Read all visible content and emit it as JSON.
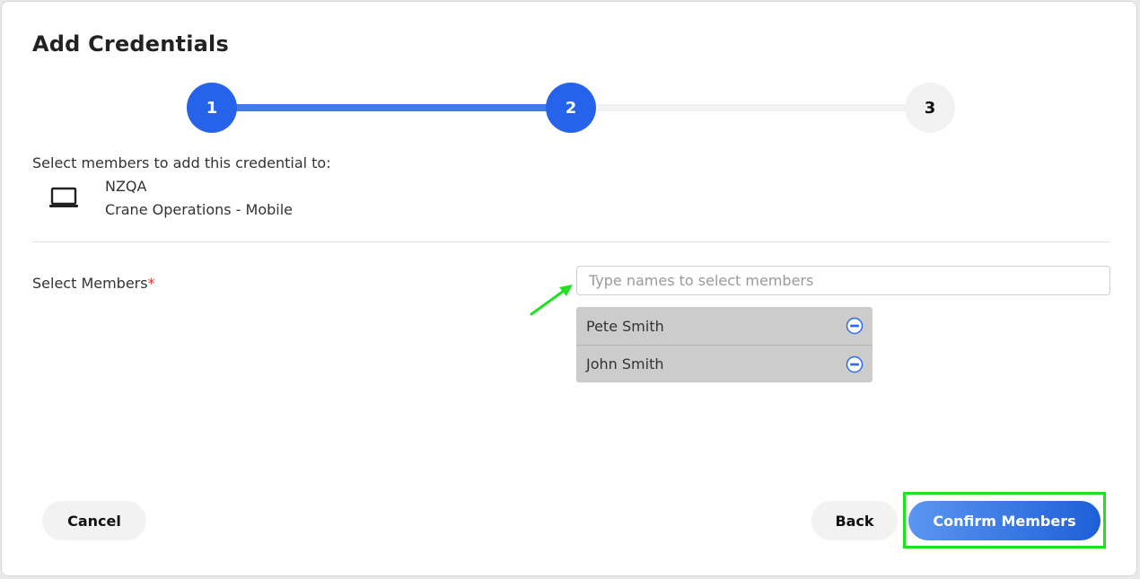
{
  "dialog": {
    "title": "Add Credentials"
  },
  "stepper": {
    "steps": [
      {
        "label": "1",
        "state": "complete"
      },
      {
        "label": "2",
        "state": "active"
      },
      {
        "label": "3",
        "state": "pending"
      }
    ],
    "active_color": "#2563eb",
    "pending_color": "#f2f2f2"
  },
  "credential": {
    "instruction": "Select members to add this credential to:",
    "icon": "laptop-icon",
    "organization": "NZQA",
    "name": "Crane Operations - Mobile"
  },
  "members": {
    "label": "Select Members",
    "required_marker": "*",
    "search_placeholder": "Type names to select members",
    "search_value": "",
    "selected": [
      {
        "name": "Pete Smith",
        "action_icon": "minus-circle-icon"
      },
      {
        "name": "John Smith",
        "action_icon": "minus-circle-icon"
      }
    ]
  },
  "footer": {
    "cancel_label": "Cancel",
    "back_label": "Back",
    "confirm_label": "Confirm Members"
  },
  "annotations": {
    "highlight_color": "#22e022",
    "arrow_color": "#22e022"
  }
}
